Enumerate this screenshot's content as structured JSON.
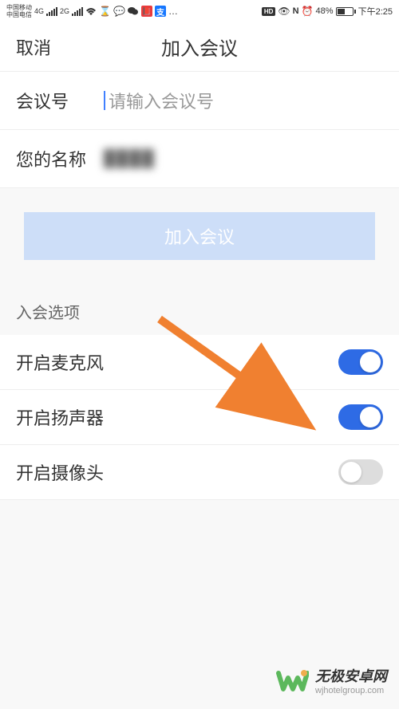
{
  "status_bar": {
    "carrier1": "中国移动",
    "carrier2": "中国电信",
    "network": "4G",
    "network2": "2G",
    "battery_pct": "48%",
    "time": "下午2:25",
    "dots": "…"
  },
  "nav": {
    "cancel": "取消",
    "title": "加入会议"
  },
  "form": {
    "meeting_id_label": "会议号",
    "meeting_id_placeholder": "请输入会议号",
    "name_label": "您的名称",
    "name_value": "████"
  },
  "join_button": "加入会议",
  "options_title": "入会选项",
  "options": {
    "mic": {
      "label": "开启麦克风",
      "on": true
    },
    "speaker": {
      "label": "开启扬声器",
      "on": true
    },
    "camera": {
      "label": "开启摄像头",
      "on": false
    }
  },
  "watermark": {
    "title": "无极安卓网",
    "url": "wjhotelgroup.com"
  }
}
